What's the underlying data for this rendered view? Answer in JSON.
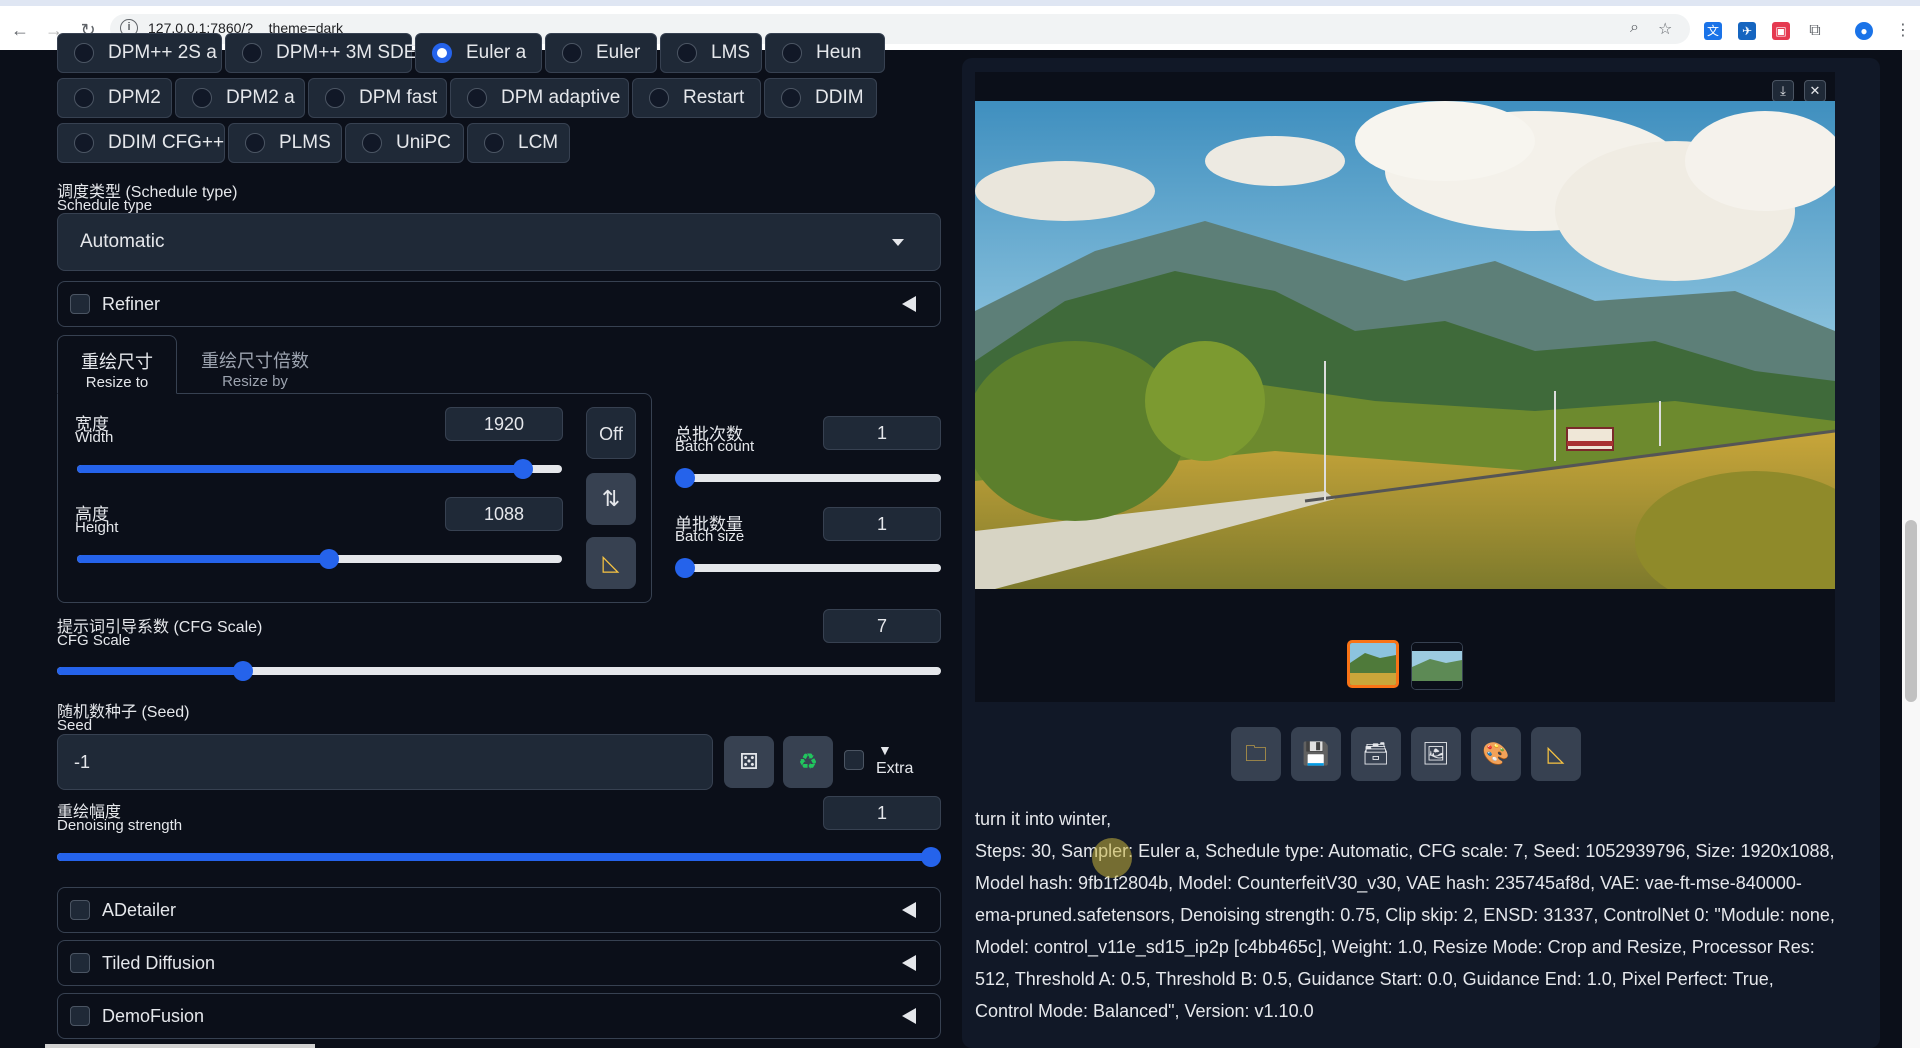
{
  "browser": {
    "url": "127.0.0.1:7860/?__theme=dark"
  },
  "samplers": {
    "row1": [
      "DPM++ 2S a",
      "DPM++ 3M SDE",
      "Euler a",
      "Euler",
      "LMS",
      "Heun"
    ],
    "row2": [
      "DPM2",
      "DPM2 a",
      "DPM fast",
      "DPM adaptive",
      "Restart",
      "DDIM"
    ],
    "row3": [
      "DDIM CFG++",
      "PLMS",
      "UniPC",
      "LCM"
    ],
    "selected": "Euler a"
  },
  "schedule": {
    "label_cn": "调度类型 (Schedule type)",
    "label_en": "Schedule type",
    "value": "Automatic"
  },
  "refiner": {
    "label": "Refiner"
  },
  "resize_tabs": {
    "tab1_cn": "重绘尺寸",
    "tab1_en": "Resize to",
    "tab2_cn": "重绘尺寸倍数",
    "tab2_en": "Resize by"
  },
  "width": {
    "label_cn": "宽度",
    "label_en": "Width",
    "value": "1920",
    "fraction": 0.92
  },
  "height": {
    "label_cn": "高度",
    "label_en": "Height",
    "value": "1088",
    "fraction": 0.52
  },
  "aspect_btn": {
    "label": "Off"
  },
  "batch_count": {
    "label_cn": "总批次数",
    "label_en": "Batch count",
    "value": "1",
    "fraction": 0.0
  },
  "batch_size": {
    "label_cn": "单批数量",
    "label_en": "Batch size",
    "value": "1",
    "fraction": 0.0
  },
  "cfg": {
    "label_cn": "提示词引导系数 (CFG Scale)",
    "label_en": "CFG Scale",
    "value": "7",
    "fraction": 0.21
  },
  "seed": {
    "label_cn": "随机数种子 (Seed)",
    "label_en": "Seed",
    "value": "-1",
    "extra_label": "Extra",
    "extra_arrow": "▼"
  },
  "denoise": {
    "label_cn": "重绘幅度",
    "label_en": "Denoising strength",
    "value": "1",
    "fraction": 1.0
  },
  "accordions": [
    "ADetailer",
    "Tiled Diffusion",
    "DemoFusion"
  ],
  "icons": {
    "swap": "swap-vertical-icon",
    "ruler": "triangle-ruler-icon",
    "dice": "dice-icon",
    "recycle": "recycle-icon",
    "download": "download-icon",
    "close": "close-icon",
    "folder": "folder-icon",
    "save": "save-icon",
    "zip": "archive-icon",
    "image": "image-icon",
    "palette": "palette-icon",
    "ruler2": "triangle-ruler-icon"
  },
  "output": {
    "prompt": "turn it into winter,",
    "params": "Steps: 30, Sampler: Euler a, Schedule type: Automatic, CFG scale: 7, Seed: 1052939796, Size: 1920x1088, Model hash: 9fb1f2804b, Model: CounterfeitV30_v30, VAE hash: 235745af8d, VAE: vae-ft-mse-840000-ema-pruned.safetensors, Denoising strength: 0.75, Clip skip: 2, ENSD: 31337, ControlNet 0: \"Module: none, Model: control_v11e_sd15_ip2p [c4bb465c], Weight: 1.0, Resize Mode: Crop and Resize, Processor Res: 512, Threshold A: 0.5, Threshold B: 0.5, Guidance Start: 0.0, Guidance End: 1.0, Pixel Perfect: True, Control Mode: Balanced\", Version: v1.10.0"
  },
  "colors": {
    "accent": "#2563eb",
    "bg": "#0b0f19",
    "panel": "#1f2937",
    "thumb_selected": "#f97316"
  }
}
